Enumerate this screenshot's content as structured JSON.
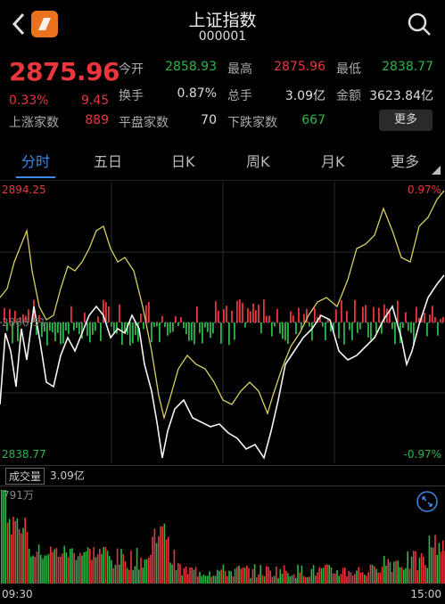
{
  "header": {
    "title": "上证指数",
    "code": "000001"
  },
  "quote": {
    "price": "2875.96",
    "pct": "0.33%",
    "change": "9.45",
    "stats": [
      {
        "label": "今开",
        "value": "2858.93",
        "color": "grn"
      },
      {
        "label": "最高",
        "value": "2875.96",
        "color": "red"
      },
      {
        "label": "最低",
        "value": "2838.77",
        "color": "grn"
      },
      {
        "label": "换手",
        "value": "0.87%",
        "color": "wht"
      },
      {
        "label": "总手",
        "value": "3.09亿",
        "color": "wht"
      },
      {
        "label": "金额",
        "value": "3623.84亿",
        "color": "wht"
      },
      {
        "label": "上涨家数",
        "value": "889",
        "color": "red"
      },
      {
        "label": "平盘家数",
        "value": "70",
        "color": "wht"
      },
      {
        "label": "下跌家数",
        "value": "667",
        "color": "grn"
      }
    ],
    "more_label": "更多"
  },
  "tabs": [
    "分时",
    "五日",
    "日K",
    "周K",
    "月K",
    "更多"
  ],
  "chart": {
    "top_left": "2894.25",
    "top_right": "0.97%",
    "bottom_left": "2838.77",
    "bottom_right": "-0.97%",
    "mid_label": "2866.51",
    "volume_label": "成交量",
    "volume_value": "3.09亿",
    "volume_max": "791万",
    "time_start": "09:30",
    "time_end": "15:00"
  },
  "colors": {
    "up": "#e8363c",
    "down": "#2db54a",
    "accent": "#3a88e8",
    "avg_line": "#d8d060"
  },
  "icons": {
    "back": "chevron-left-icon",
    "logo": "app-logo",
    "search": "search-icon"
  }
}
